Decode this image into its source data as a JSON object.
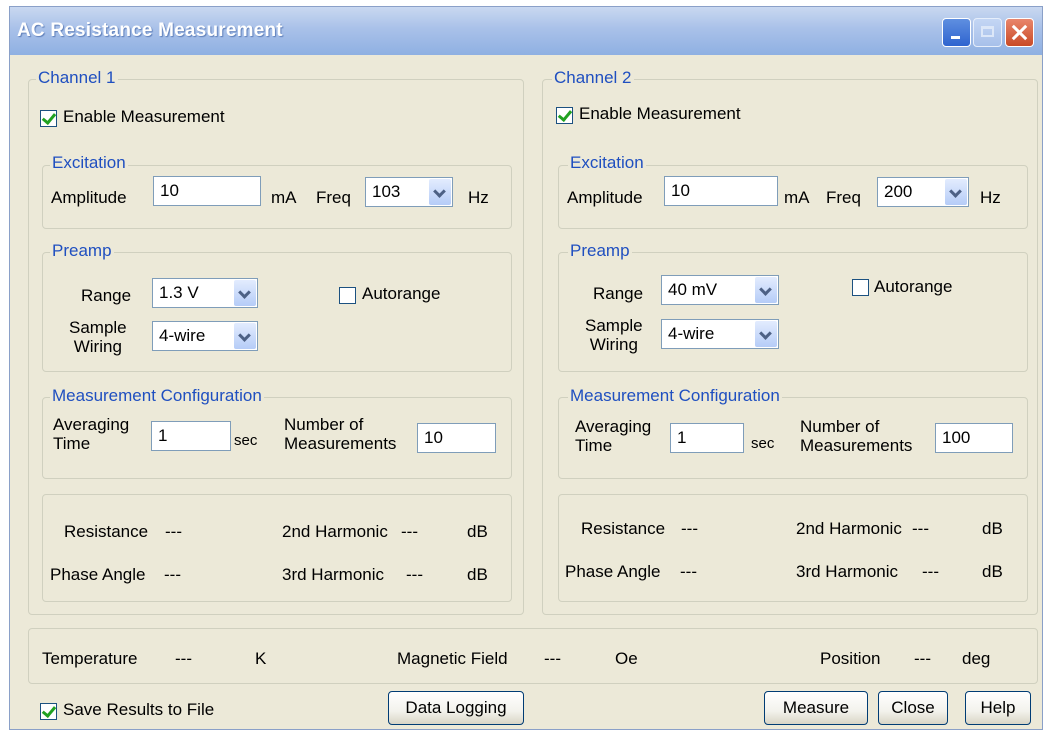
{
  "window": {
    "title": "AC Resistance Measurement"
  },
  "channels": [
    {
      "label": "Channel 1",
      "enable_label": "Enable Measurement",
      "enable_checked": true,
      "excitation": {
        "label": "Excitation",
        "amplitude_label": "Amplitude",
        "amplitude_value": "10",
        "amplitude_unit": "mA",
        "freq_label": "Freq",
        "freq_value": "103",
        "freq_unit": "Hz"
      },
      "preamp": {
        "label": "Preamp",
        "range_label": "Range",
        "range_value": "1.3 V",
        "autorange_label": "Autorange",
        "autorange_checked": false,
        "wiring_label_1": "Sample",
        "wiring_label_2": "Wiring",
        "wiring_value": "4-wire"
      },
      "config": {
        "label": "Measurement Configuration",
        "avg_label_1": "Averaging",
        "avg_label_2": "Time",
        "avg_value": "1",
        "avg_unit": "sec",
        "num_label_1": "Number of",
        "num_label_2": "Measurements",
        "num_value": "10"
      },
      "results": {
        "resistance_label": "Resistance",
        "resistance_value": "---",
        "phase_label": "Phase Angle",
        "phase_value": "---",
        "h2_label": "2nd Harmonic",
        "h2_value": "---",
        "h2_unit": "dB",
        "h3_label": "3rd Harmonic",
        "h3_value": "---",
        "h3_unit": "dB"
      }
    },
    {
      "label": "Channel 2",
      "enable_label": "Enable Measurement",
      "enable_checked": true,
      "excitation": {
        "label": "Excitation",
        "amplitude_label": "Amplitude",
        "amplitude_value": "10",
        "amplitude_unit": "mA",
        "freq_label": "Freq",
        "freq_value": "200",
        "freq_unit": "Hz"
      },
      "preamp": {
        "label": "Preamp",
        "range_label": "Range",
        "range_value": "40 mV",
        "autorange_label": "Autorange",
        "autorange_checked": false,
        "wiring_label_1": "Sample",
        "wiring_label_2": "Wiring",
        "wiring_value": "4-wire"
      },
      "config": {
        "label": "Measurement Configuration",
        "avg_label_1": "Averaging",
        "avg_label_2": "Time",
        "avg_value": "1",
        "avg_unit": "sec",
        "num_label_1": "Number of",
        "num_label_2": "Measurements",
        "num_value": "100"
      },
      "results": {
        "resistance_label": "Resistance",
        "resistance_value": "---",
        "phase_label": "Phase Angle",
        "phase_value": "---",
        "h2_label": "2nd Harmonic",
        "h2_value": "---",
        "h2_unit": "dB",
        "h3_label": "3rd Harmonic",
        "h3_value": "---",
        "h3_unit": "dB"
      }
    }
  ],
  "status": {
    "temperature_label": "Temperature",
    "temperature_value": "---",
    "temperature_unit": "K",
    "field_label": "Magnetic Field",
    "field_value": "---",
    "field_unit": "Oe",
    "position_label": "Position",
    "position_value": "---",
    "position_unit": "deg"
  },
  "footer": {
    "save_label": "Save Results to File",
    "save_checked": true,
    "data_logging_label": "Data Logging",
    "measure_label": "Measure",
    "close_label": "Close",
    "help_label": "Help"
  }
}
